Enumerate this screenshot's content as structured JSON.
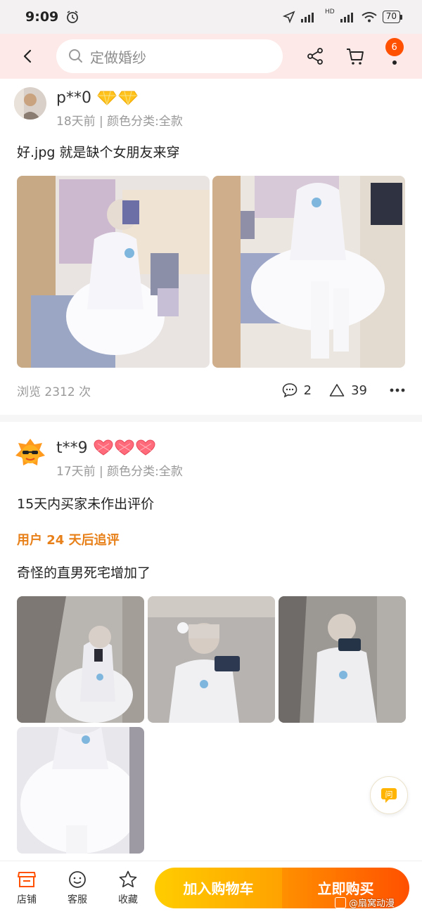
{
  "status_bar": {
    "time": "9:09",
    "network_label": "HD",
    "battery": "70"
  },
  "nav": {
    "search_placeholder": "定做婚纱",
    "menu_badge": "6"
  },
  "reviews": [
    {
      "username": "p**0",
      "level_badge": "diamond",
      "meta": "18天前 | 颜色分类:全款",
      "text": "好.jpg  就是缺个女朋友来穿",
      "views": "浏览 2312 次",
      "comments": "2",
      "likes": "39"
    },
    {
      "username": "t**9",
      "level_badge": "heart",
      "meta": "17天前 | 颜色分类:全款",
      "text": "15天内买家未作出评价",
      "followup_label": "用户 24 天后追评",
      "followup_text": "奇怪的直男死宅增加了"
    }
  ],
  "bottom_bar": {
    "tabs": [
      {
        "label": "店铺",
        "icon": "store-icon"
      },
      {
        "label": "客服",
        "icon": "customer-service-icon"
      },
      {
        "label": "收藏",
        "icon": "star-icon"
      }
    ],
    "cart_label": "加入购物车",
    "buy_label": "立即购买"
  },
  "watermark": "@扇窝动漫",
  "colors": {
    "accent": "#ff5000",
    "cart_yellow": "#ffb800",
    "followup": "#e8801a",
    "nav_bg": "#fde9e7"
  }
}
